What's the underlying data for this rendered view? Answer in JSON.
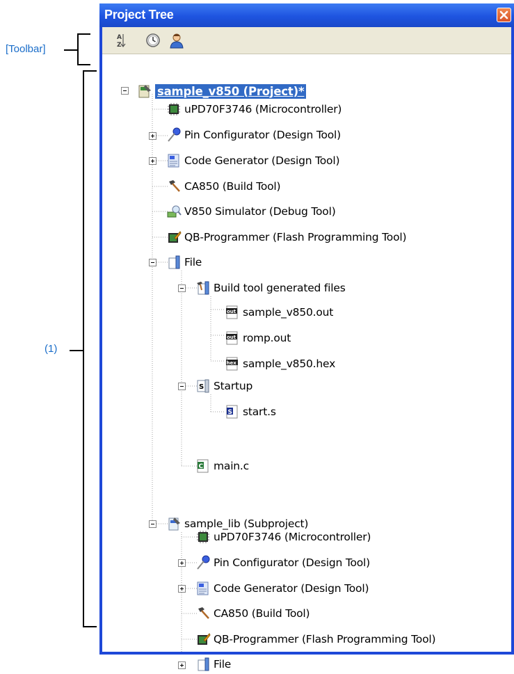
{
  "annotations": {
    "toolbar": "[Toolbar]",
    "area1": "(1)"
  },
  "window": {
    "title": "Project Tree",
    "close_icon": "close-icon"
  },
  "toolbar": {
    "buttons": [
      {
        "icon": "sort-az-icon"
      },
      {
        "icon": "clock-icon"
      },
      {
        "icon": "person-icon"
      }
    ]
  },
  "tree": {
    "nodes": [
      {
        "label": "sample_v850 (Project)*",
        "icon": "project-icon"
      },
      {
        "label": "uPD70F3746 (Microcontroller)",
        "icon": "chip-icon"
      },
      {
        "label": "Pin Configurator (Design Tool)",
        "icon": "pin-icon"
      },
      {
        "label": "Code Generator (Design Tool)",
        "icon": "code-generator-icon"
      },
      {
        "label": "CA850 (Build Tool)",
        "icon": "hammer-icon"
      },
      {
        "label": "V850 Simulator (Debug Tool)",
        "icon": "simulator-icon"
      },
      {
        "label": "QB-Programmer (Flash Programming Tool)",
        "icon": "flash-icon"
      },
      {
        "label": "File",
        "icon": "folder-icon"
      },
      {
        "label": "Build tool generated files",
        "icon": "build-folder-icon"
      },
      {
        "label": "sample_v850.out",
        "icon": "out-file-icon"
      },
      {
        "label": "romp.out",
        "icon": "out-file-icon"
      },
      {
        "label": "sample_v850.hex",
        "icon": "hex-file-icon"
      },
      {
        "label": "Startup",
        "icon": "s-folder-icon"
      },
      {
        "label": "start.s",
        "icon": "s-file-icon"
      },
      {
        "label": "main.c",
        "icon": "c-file-icon"
      },
      {
        "label": "sample_lib (Subproject)",
        "icon": "subproject-icon"
      },
      {
        "label": "uPD70F3746 (Microcontroller)",
        "icon": "chip-icon"
      },
      {
        "label": "Pin Configurator (Design Tool)",
        "icon": "pin-icon"
      },
      {
        "label": "Code Generator (Design Tool)",
        "icon": "code-generator-icon"
      },
      {
        "label": "CA850 (Build Tool)",
        "icon": "hammer-icon"
      },
      {
        "label": "QB-Programmer (Flash Programming Tool)",
        "icon": "flash-icon"
      },
      {
        "label": "File",
        "icon": "folder-icon"
      }
    ],
    "file_icon_texts": {
      "out": "out",
      "hex": "hex",
      "s": "S",
      "c": "C"
    }
  }
}
